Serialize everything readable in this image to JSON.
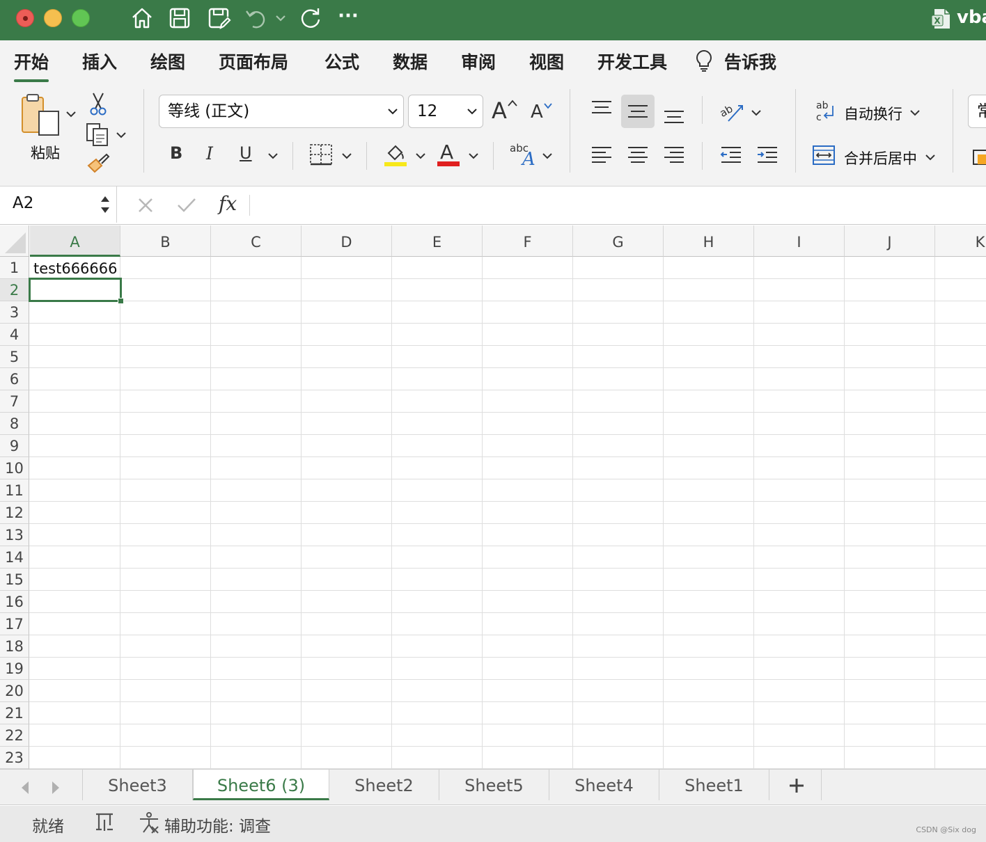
{
  "window": {
    "doc_title": "vba",
    "toolbar_icons": [
      "home-icon",
      "save-icon",
      "save-edit-icon",
      "undo-icon",
      "redo-icon",
      "more-icon"
    ],
    "more_label": "···"
  },
  "ribbon": {
    "tabs": [
      {
        "label": "开始",
        "active": true
      },
      {
        "label": "插入"
      },
      {
        "label": "绘图"
      },
      {
        "label": "页面布局"
      },
      {
        "label": "公式"
      },
      {
        "label": "数据"
      },
      {
        "label": "审阅"
      },
      {
        "label": "视图"
      },
      {
        "label": "开发工具"
      },
      {
        "label": "告诉我"
      }
    ],
    "clipboard": {
      "paste_label": "粘贴"
    },
    "font": {
      "name": "等线 (正文)",
      "size": "12",
      "bold": "B",
      "italic": "I",
      "underline": "U",
      "grow": "A",
      "shrink": "A",
      "font_color_letter": "A",
      "abc_label": "abc",
      "highlight_color": "#f7e81a",
      "font_color": "#e02020"
    },
    "alignment": {
      "wrap_text": "自动换行",
      "merge_center": "合并后居中",
      "next_group_partial": "常"
    }
  },
  "formula_bar": {
    "name_box": "A2",
    "fx_label": "fx",
    "formula": ""
  },
  "grid": {
    "columns": [
      "A",
      "B",
      "C",
      "D",
      "E",
      "F",
      "G",
      "H",
      "I",
      "J",
      "K"
    ],
    "rows": [
      "1",
      "2",
      "3",
      "4",
      "5",
      "6",
      "7",
      "8",
      "9",
      "10",
      "11",
      "12",
      "13",
      "14",
      "15",
      "16",
      "17",
      "18",
      "19",
      "20",
      "21",
      "22",
      "23"
    ],
    "selected_column": "A",
    "selected_row": "2",
    "cells": {
      "A1": "test666666"
    }
  },
  "sheets": {
    "tabs": [
      "Sheet3",
      "Sheet6 (3)",
      "Sheet2",
      "Sheet5",
      "Sheet4",
      "Sheet1"
    ],
    "active": "Sheet6 (3)",
    "add_label": "+"
  },
  "status": {
    "ready": "就绪",
    "accessibility": "辅助功能: 调查",
    "watermark": "CSDN @Six dog"
  },
  "colors": {
    "accent": "#3a7a48",
    "titlebar": "#3a7a48"
  }
}
